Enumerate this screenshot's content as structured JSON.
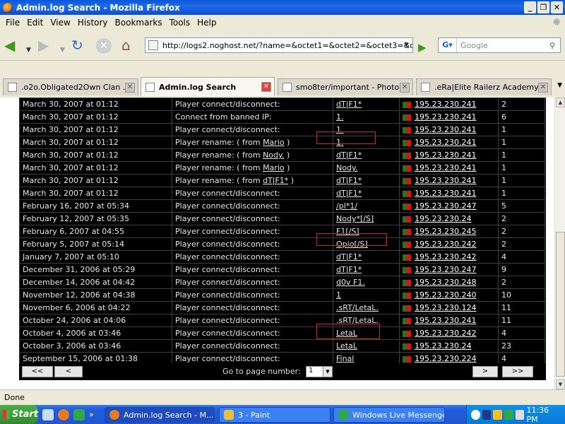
{
  "window": {
    "title": "Admin.log Search - Mozilla Firefox"
  },
  "menu": [
    "File",
    "Edit",
    "View",
    "History",
    "Bookmarks",
    "Tools",
    "Help"
  ],
  "nav": {
    "url": "http://logs2.noghost.net/?name=&octet1=&octet2=&octet3=&octet",
    "search_placeholder": "Google"
  },
  "tabs": [
    {
      "label": ".o2o.Obligated2Own Clan ...",
      "active": false
    },
    {
      "label": "Admin.log Search",
      "active": true
    },
    {
      "label": "smo8ter/important - Photo...",
      "active": false
    },
    {
      "label": ".eRa|Elite Railerz Academy...",
      "active": false
    }
  ],
  "log": {
    "rows": [
      {
        "date": "March 30, 2007 at 01:12",
        "action": "Player connect/disconnect:",
        "from": "",
        "nick": "dT|F1*",
        "ip": "195.23.230.241",
        "count": "2"
      },
      {
        "date": "March 30, 2007 at 01:12",
        "action": "Connect from banned IP:",
        "from": "",
        "nick": "1.",
        "ip": "195.23.230.241",
        "count": "6"
      },
      {
        "date": "March 30, 2007 at 01:12",
        "action": "Player connect/disconnect:",
        "from": "",
        "nick": "1.",
        "ip": "195.23.230.241",
        "count": "1"
      },
      {
        "date": "March 30, 2007 at 01:12",
        "action": "Player rename: ( from ",
        "from": "Mario",
        "nick": "1.",
        "ip": "195.23.230.241",
        "count": "1"
      },
      {
        "date": "March 30, 2007 at 01:12",
        "action": "Player rename: ( from ",
        "from": "Nody.",
        "nick": "dT|F1*",
        "ip": "195.23.230.241",
        "count": "1"
      },
      {
        "date": "March 30, 2007 at 01:12",
        "action": "Player rename: ( from ",
        "from": "Mario",
        "nick": "Nody.",
        "ip": "195.23.230.241",
        "count": "1"
      },
      {
        "date": "March 30, 2007 at 01:12",
        "action": "Player rename: ( from ",
        "from": "dT|F1*",
        "nick": "dT|F1*",
        "ip": "195.23.230.241",
        "count": "1"
      },
      {
        "date": "March 30, 2007 at 01:12",
        "action": "Player connect/disconnect:",
        "from": "",
        "nick": "dT|F1*",
        "ip": "195.23.230.241",
        "count": "1"
      },
      {
        "date": "February 16, 2007 at 05:34",
        "action": "Player connect/disconnect:",
        "from": "",
        "nick": "/pl*1/",
        "ip": "195.23.230.247",
        "count": "5"
      },
      {
        "date": "February 12, 2007 at 05:35",
        "action": "Player connect/disconnect:",
        "from": "",
        "nick": "Nody*[/S]",
        "ip": "195.23.230.24",
        "count": "2"
      },
      {
        "date": "February 6, 2007 at 04:55",
        "action": "Player connect/disconnect:",
        "from": "",
        "nick": "F1[/S]",
        "ip": "195.23.230.245",
        "count": "2"
      },
      {
        "date": "February 5, 2007 at 05:14",
        "action": "Player connect/disconnect:",
        "from": "",
        "nick": "Opio[/S]",
        "ip": "195.23.230.242",
        "count": "2"
      },
      {
        "date": "January 7, 2007 at 05:10",
        "action": "Player connect/disconnect:",
        "from": "",
        "nick": "dT|F1*",
        "ip": "195.23.230.242",
        "count": "4"
      },
      {
        "date": "December 31, 2006 at 05:29",
        "action": "Player connect/disconnect:",
        "from": "",
        "nick": "dT|F1*",
        "ip": "195.23.230.247",
        "count": "9"
      },
      {
        "date": "December 14, 2006 at 04:42",
        "action": "Player connect/disconnect:",
        "from": "",
        "nick": "d0v F1.",
        "ip": "195.23.230.248",
        "count": "2"
      },
      {
        "date": "November 12, 2006 at 04:38",
        "action": "Player connect/disconnect:",
        "from": "",
        "nick": "1",
        "ip": "195.23.230.240",
        "count": "10"
      },
      {
        "date": "November 6, 2006 at 04:22",
        "action": "Player connect/disconnect:",
        "from": "",
        "nick": ".sRT/LetaL.",
        "ip": "195.23.230.124",
        "count": "11"
      },
      {
        "date": "October 24, 2006 at 04:06",
        "action": "Player connect/disconnect:",
        "from": "",
        "nick": ".sRT/LetaL.",
        "ip": "195.23.230.241",
        "count": "11"
      },
      {
        "date": "October 4, 2006 at 03:46",
        "action": "Player connect/disconnect:",
        "from": "",
        "nick": "LetaL",
        "ip": "195.23.230.242",
        "count": "4"
      },
      {
        "date": "October 3, 2006 at 03:46",
        "action": "Player connect/disconnect:",
        "from": "",
        "nick": "LetaL",
        "ip": "195.23.230.24",
        "count": "23"
      },
      {
        "date": "September 15, 2006 at 01:38",
        "action": "Player connect/disconnect:",
        "from": "",
        "nick": "Final",
        "ip": "195.23.230.224",
        "count": "4"
      }
    ],
    "rename_suffix": " )"
  },
  "pager": {
    "first": "<<",
    "prev": "<",
    "goto_label": "Go to page number:",
    "page": "1",
    "next": ">",
    "last": ">>"
  },
  "status": "Done",
  "taskbar": {
    "start": "Start",
    "items": [
      {
        "label": "Admin.log Search - M...",
        "active": true
      },
      {
        "label": "3 - Paint",
        "active": false
      },
      {
        "label": "Windows Live Messenger",
        "active": false
      }
    ],
    "clock": "11:36 PM"
  }
}
